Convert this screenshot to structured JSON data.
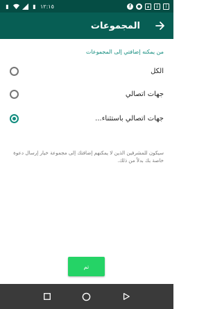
{
  "status_bar": {
    "time": "١٢:١٥",
    "icons": [
      "sim-icon",
      "wifi-icon",
      "signal-icon",
      "battery-icon",
      "facebook-icon",
      "notification-icon",
      "photo-icon",
      "download-icon",
      "info-icon"
    ]
  },
  "app_bar": {
    "title": "المجموعات",
    "back_icon": "arrow-right-icon"
  },
  "section_title": "من يمكنه إضافتي إلى المجموعات",
  "options": [
    {
      "label": "الكل",
      "checked": false
    },
    {
      "label": "جهات اتصالي",
      "checked": false
    },
    {
      "label": "جهات اتصالي باستثناء...",
      "checked": true
    }
  ],
  "note": "سيكون للمشرفين الذين لا يمكنهم إضافتك إلى مجموعة خيار إرسال دعوة خاصة بك بدلاً من ذلك.",
  "done_button": "تم",
  "nav_bar": [
    "back-triangle-icon",
    "home-circle-icon",
    "recents-square-icon"
  ],
  "colors": {
    "status_bar": "#054d44",
    "app_bar": "#075e54",
    "accent": "#128c7e",
    "button": "#25d366",
    "nav_bar": "#3a3a3a"
  }
}
